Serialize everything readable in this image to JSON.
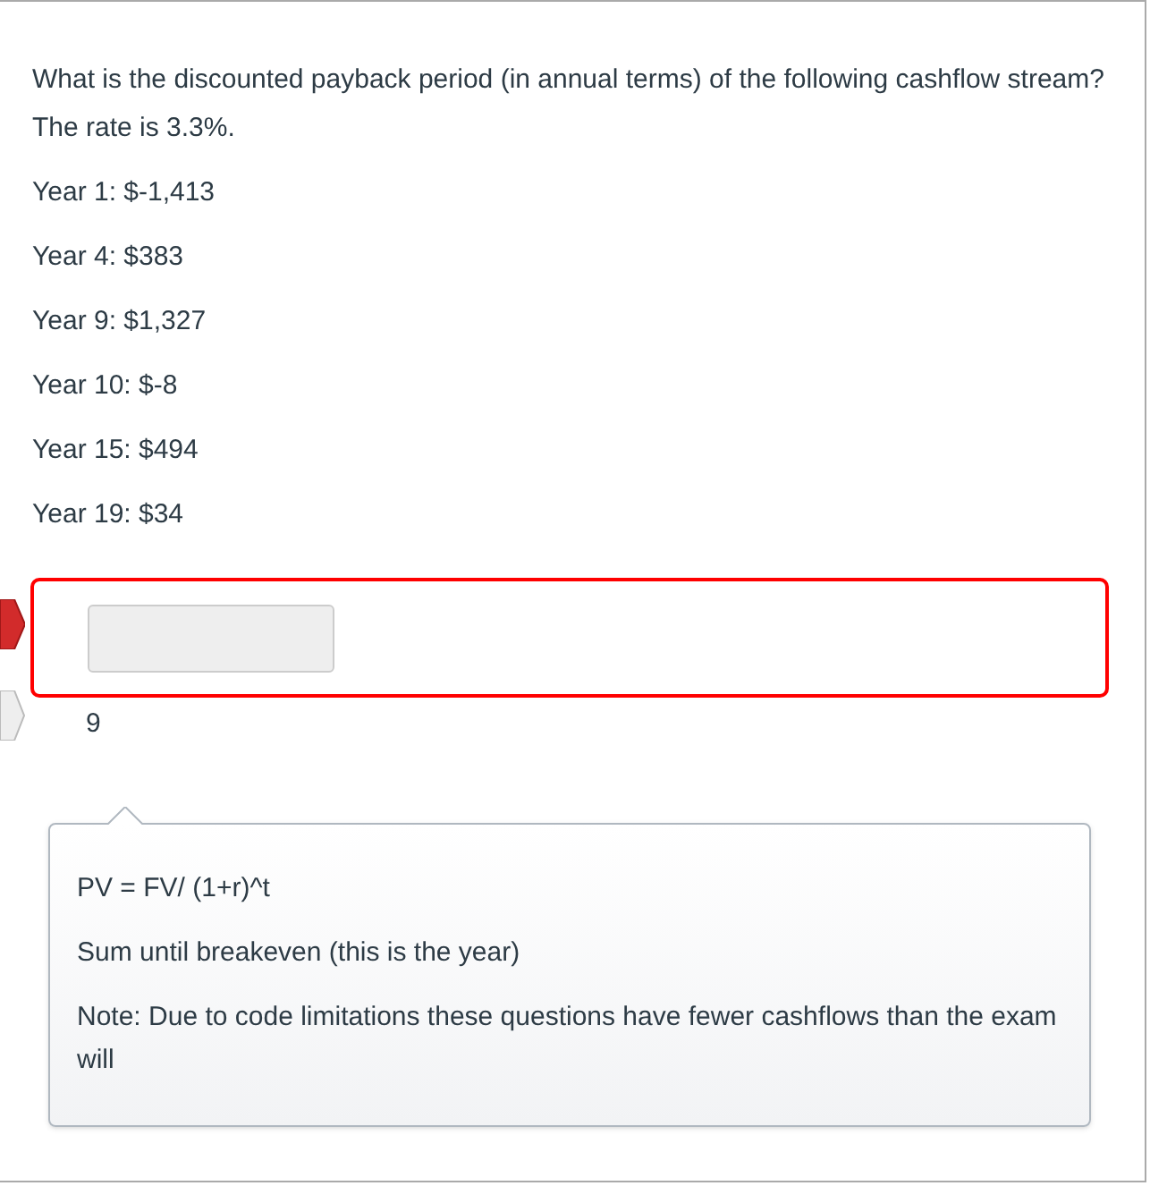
{
  "question": {
    "text": "What is the discounted payback period (in annual terms) of the following cashflow stream?  The rate is 3.3%.",
    "cashflows": [
      "Year 1: $-1,413",
      "Year 4: $383",
      "Year 9: $1,327",
      "Year 10: $-8",
      "Year 15: $494",
      "Year 19: $34"
    ]
  },
  "answers": [
    {
      "kind": "your_answer",
      "correct": false
    },
    {
      "kind": "correct_answer",
      "text": "9"
    }
  ],
  "comment": {
    "lines": [
      "PV = FV/ (1+r)^t",
      "Sum until breakeven (this is the year)",
      "Note: Due to code limitations these questions have fewer cashflows than the exam will"
    ]
  }
}
